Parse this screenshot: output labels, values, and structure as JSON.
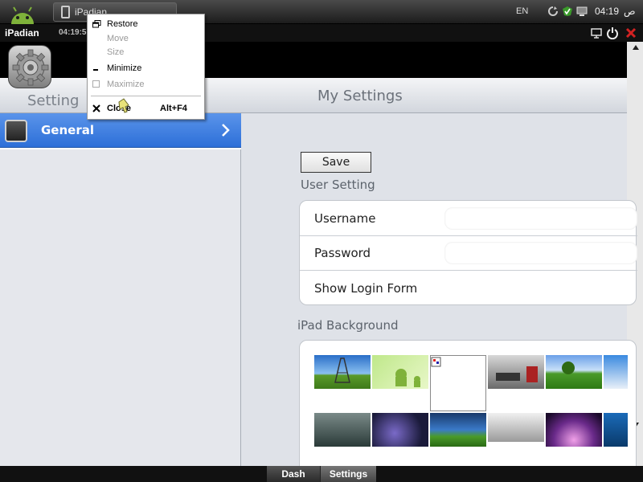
{
  "taskbar": {
    "task_label": "iPadian",
    "language": "EN",
    "time": "04:19",
    "ampm": "ص"
  },
  "app": {
    "title": "iPadian",
    "clock": "04:19:5"
  },
  "header": {
    "left_title": "Setting",
    "main_title": "My Settings"
  },
  "sidebar": {
    "items": [
      {
        "label": "General",
        "selected": true
      }
    ]
  },
  "main": {
    "save_label": "Save",
    "user_section_title": "User Setting",
    "rows": [
      {
        "label": "Username",
        "value": ""
      },
      {
        "label": "Password",
        "value": ""
      },
      {
        "label": "Show Login Form"
      }
    ],
    "background_section_title": "iPad Background",
    "thumbnails": [
      {
        "name": "eiffel-tower"
      },
      {
        "name": "android-green"
      },
      {
        "name": "blank-selected"
      },
      {
        "name": "modern-interior"
      },
      {
        "name": "green-field"
      },
      {
        "name": "snow-blue"
      },
      {
        "name": "rain-glass"
      },
      {
        "name": "purple-nebula"
      },
      {
        "name": "night-landscape"
      },
      {
        "name": "grey-gradient"
      },
      {
        "name": "purple-light"
      },
      {
        "name": "hut-water"
      }
    ]
  },
  "context_menu": {
    "items": [
      {
        "label": "Restore",
        "enabled": true,
        "icon": "restore-icon"
      },
      {
        "label": "Move",
        "enabled": false
      },
      {
        "label": "Size",
        "enabled": false
      },
      {
        "label": "Minimize",
        "enabled": true,
        "icon": "minimize-icon"
      },
      {
        "label": "Maximize",
        "enabled": false,
        "icon": "maximize-icon"
      },
      {
        "label": "Close",
        "enabled": true,
        "icon": "close-icon",
        "shortcut": "Alt+F4"
      }
    ]
  },
  "bottom_tabs": [
    {
      "label": "Dash"
    },
    {
      "label": "Settings",
      "active": true
    }
  ],
  "colors": {
    "selection_blue": "#3a7be0",
    "close_red": "#d22222"
  }
}
